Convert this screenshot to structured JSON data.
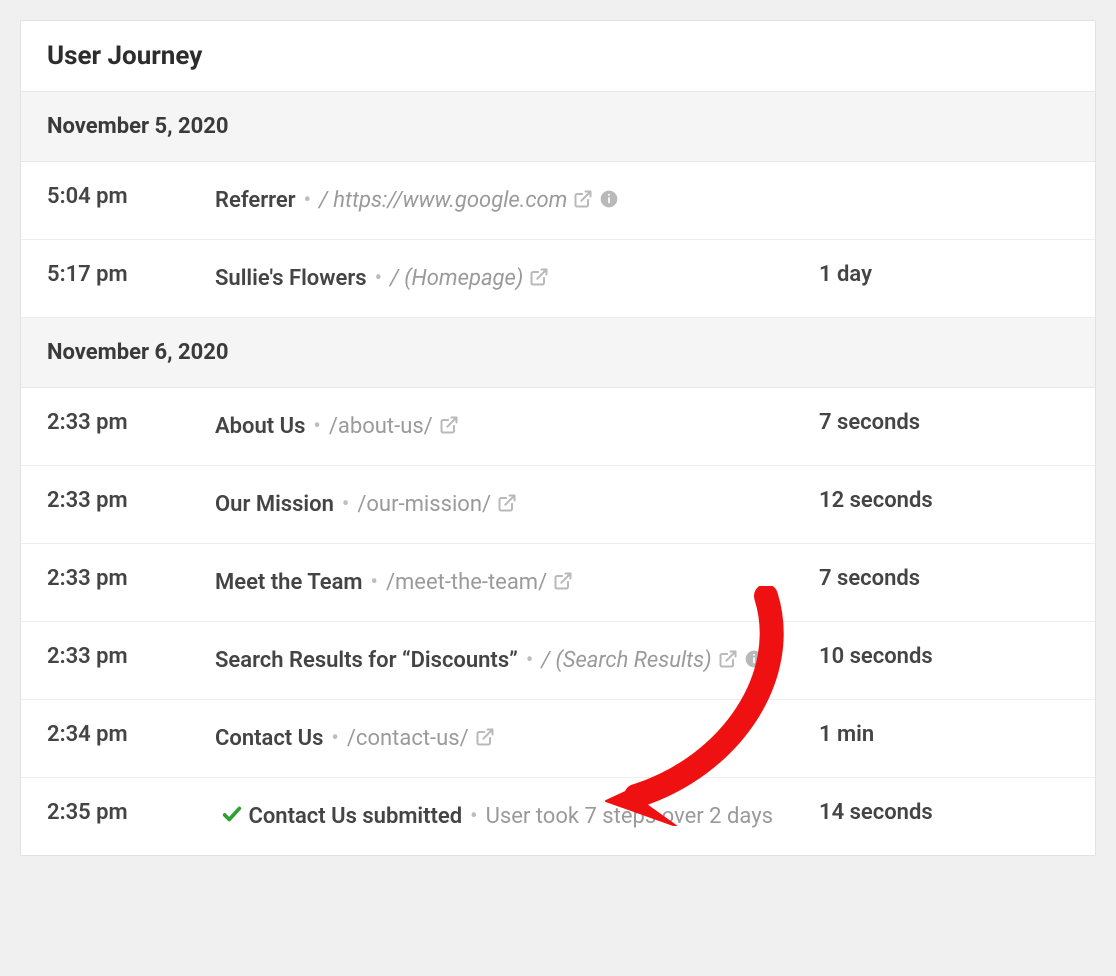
{
  "card": {
    "title": "User Journey"
  },
  "sections": [
    {
      "date": "November 5, 2020",
      "rows": [
        {
          "time": "5:04 pm",
          "title": "Referrer",
          "path": "/ https://www.google.com",
          "path_italic": true,
          "external": true,
          "info": true,
          "check": false,
          "duration": ""
        },
        {
          "time": "5:17 pm",
          "title": "Sullie's Flowers",
          "path": "/ (Homepage)",
          "path_italic": true,
          "external": true,
          "info": false,
          "check": false,
          "duration": "1 day"
        }
      ]
    },
    {
      "date": "November 6, 2020",
      "rows": [
        {
          "time": "2:33 pm",
          "title": "About Us",
          "path": "/about-us/",
          "path_italic": false,
          "external": true,
          "info": false,
          "check": false,
          "duration": "7 seconds"
        },
        {
          "time": "2:33 pm",
          "title": "Our Mission",
          "path": "/our-mission/",
          "path_italic": false,
          "external": true,
          "info": false,
          "check": false,
          "duration": "12 seconds"
        },
        {
          "time": "2:33 pm",
          "title": "Meet the Team",
          "path": "/meet-the-team/",
          "path_italic": false,
          "external": true,
          "info": false,
          "check": false,
          "duration": "7 seconds"
        },
        {
          "time": "2:33 pm",
          "title": "Search Results for “Discounts”",
          "path": "/ (Search Results)",
          "path_italic": true,
          "external": true,
          "info": true,
          "check": false,
          "duration": "10 seconds"
        },
        {
          "time": "2:34 pm",
          "title": "Contact Us",
          "path": "/contact-us/",
          "path_italic": false,
          "external": true,
          "info": false,
          "check": false,
          "duration": "1 min"
        },
        {
          "time": "2:35 pm",
          "title": "Contact Us submitted",
          "path": "User took 7 steps over 2 days",
          "path_italic": false,
          "external": false,
          "info": false,
          "check": true,
          "duration": "14 seconds"
        }
      ]
    }
  ]
}
